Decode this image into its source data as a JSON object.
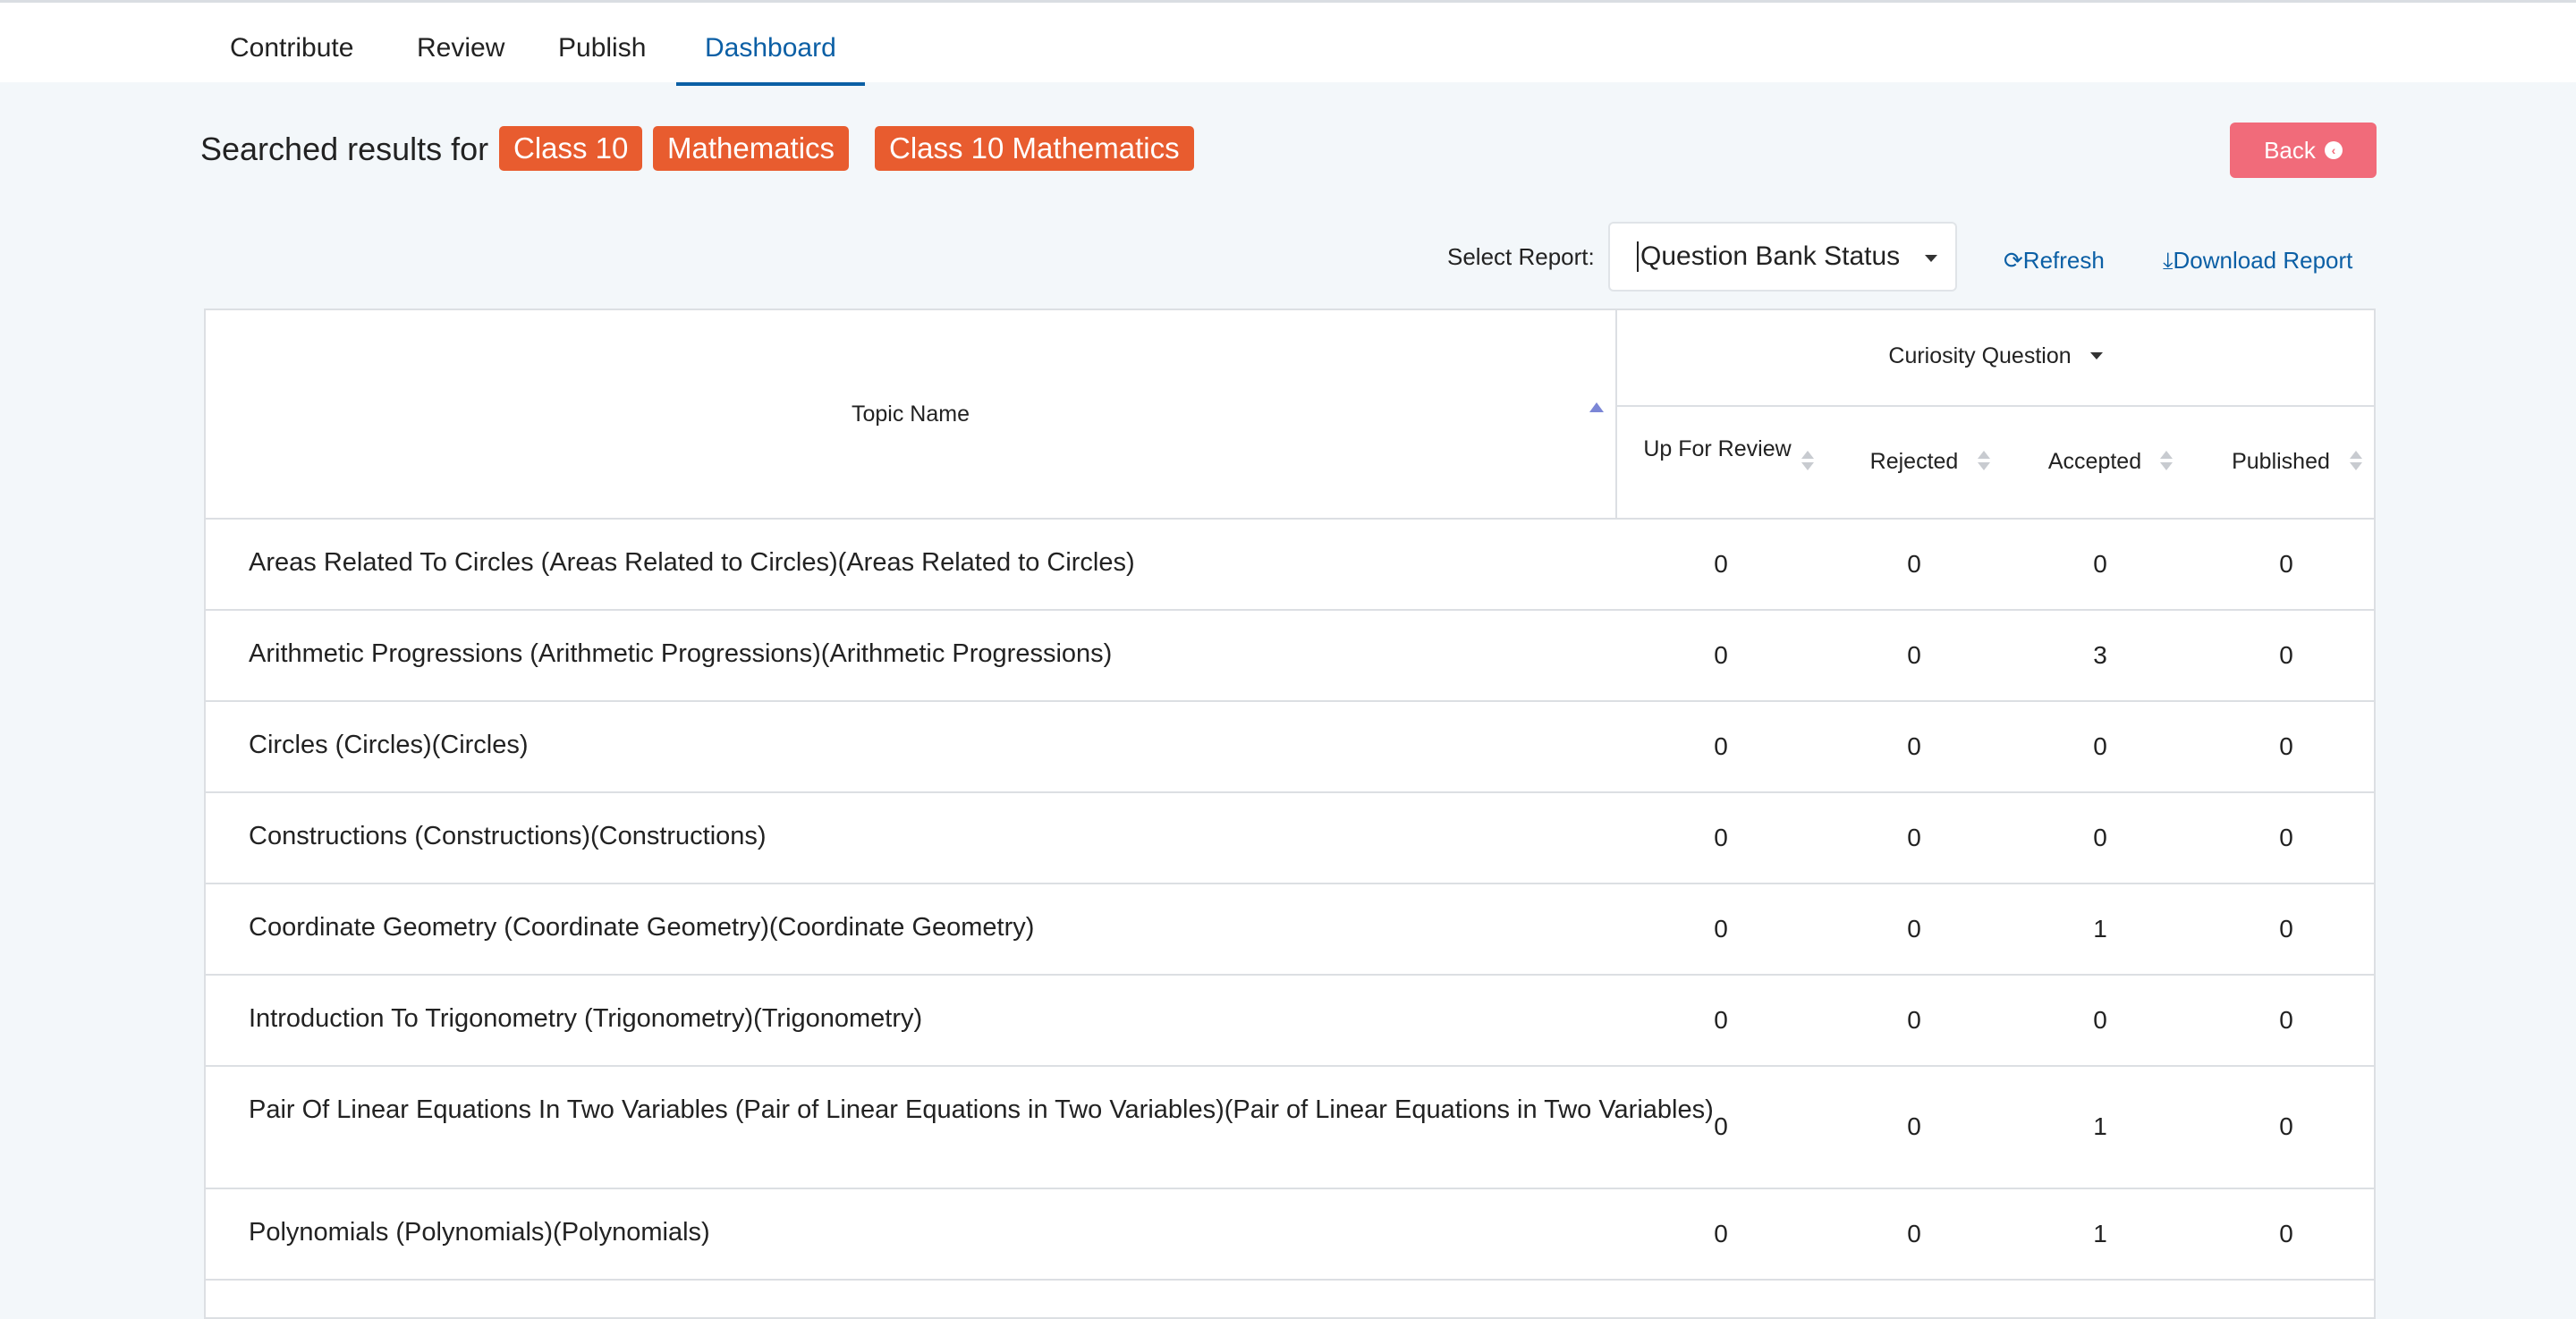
{
  "nav": {
    "tabs": [
      {
        "label": "Contribute"
      },
      {
        "label": "Review"
      },
      {
        "label": "Publish"
      },
      {
        "label": "Dashboard",
        "active": true
      }
    ]
  },
  "search": {
    "label": "Searched results for",
    "chips": [
      "Class 10",
      "Mathematics",
      "Class 10 Mathematics"
    ],
    "chip_color": "#e85c2f"
  },
  "back_button": {
    "label": "Back",
    "icon": "chevron-left-circle-icon",
    "color": "#f16b7a"
  },
  "report": {
    "select_label": "Select Report:",
    "selected": "Question Bank Status",
    "refresh_label": "Refresh",
    "refresh_icon": "refresh-icon",
    "download_label": "Download Report",
    "download_icon": "download-icon"
  },
  "table": {
    "topic_header": "Topic Name",
    "group_header": "Curiosity Question",
    "columns": [
      "Up For Review",
      "Rejected",
      "Accepted",
      "Published"
    ],
    "rows": [
      {
        "topic": "Areas Related To Circles (Areas Related to Circles)(Areas Related to Circles)",
        "values": [
          "0",
          "0",
          "0",
          "0"
        ]
      },
      {
        "topic": "Arithmetic Progressions (Arithmetic Progressions)(Arithmetic Progressions)",
        "values": [
          "0",
          "0",
          "3",
          "0"
        ]
      },
      {
        "topic": "Circles (Circles)(Circles)",
        "values": [
          "0",
          "0",
          "0",
          "0"
        ]
      },
      {
        "topic": "Constructions (Constructions)(Constructions)",
        "values": [
          "0",
          "0",
          "0",
          "0"
        ]
      },
      {
        "topic": "Coordinate Geometry (Coordinate Geometry)(Coordinate Geometry)",
        "values": [
          "0",
          "0",
          "1",
          "0"
        ]
      },
      {
        "topic": "Introduction To Trigonometry (Trigonometry)(Trigonometry)",
        "values": [
          "0",
          "0",
          "0",
          "0"
        ]
      },
      {
        "topic": "Pair Of Linear Equations In Two Variables (Pair of Linear Equations in Two Variables)(Pair of Linear Equations in Two Variables)",
        "values": [
          "0",
          "0",
          "1",
          "0"
        ]
      },
      {
        "topic": "Polynomials (Polynomials)(Polynomials)",
        "values": [
          "0",
          "0",
          "1",
          "0"
        ]
      }
    ]
  },
  "colors": {
    "accent": "#0b5fa5",
    "background": "#f3f7fa"
  }
}
